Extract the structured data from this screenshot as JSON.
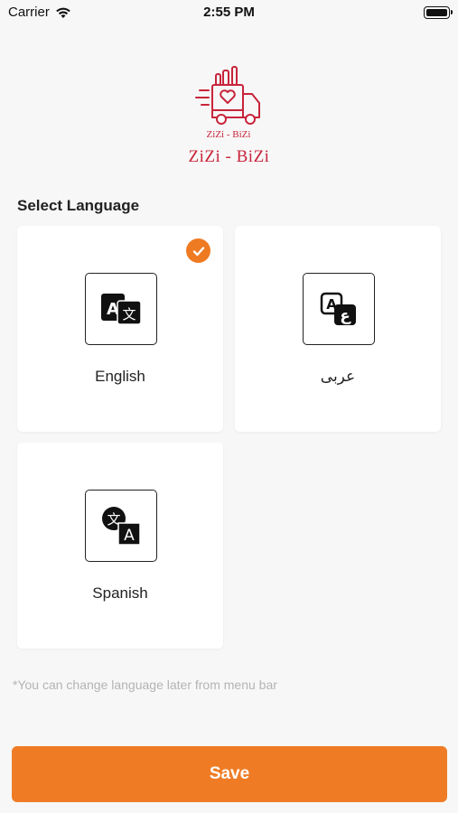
{
  "status_bar": {
    "carrier": "Carrier",
    "time": "2:55 PM",
    "battery_level": 1.0
  },
  "logo": {
    "emblem_text": "ZiZi - BiZi",
    "title": "ZiZi - BiZi",
    "brand_color": "#c8243b"
  },
  "section": {
    "title": "Select Language"
  },
  "languages": [
    {
      "label": "English",
      "icon": "translate-a-icon",
      "selected": true
    },
    {
      "label": "عربى",
      "icon": "translate-arabic-icon",
      "selected": false
    },
    {
      "label": "Spanish",
      "icon": "translate-glyph-icon",
      "selected": false
    }
  ],
  "note": "*You can change language later from menu bar",
  "save_button": {
    "label": "Save"
  },
  "colors": {
    "accent": "#ef7c25",
    "background": "#f7f7f7",
    "card": "#ffffff",
    "note": "#b4b4b4"
  }
}
